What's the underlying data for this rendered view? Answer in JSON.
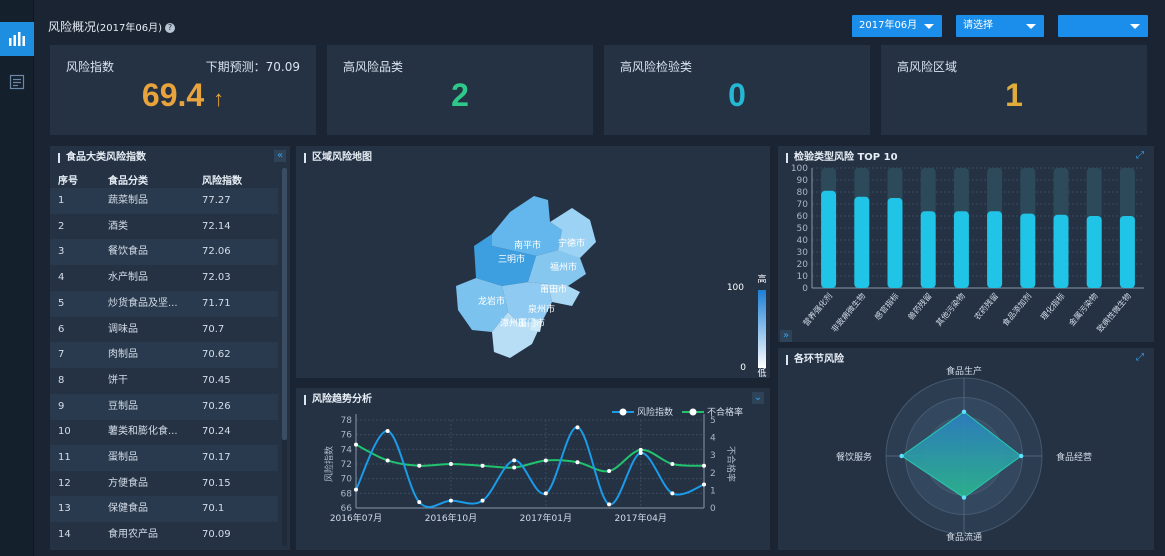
{
  "header": {
    "title": "风险概况",
    "period": "(2017年06月)",
    "help": "?",
    "month_select": "2017年06月",
    "category_select": "请选择",
    "region_select": ""
  },
  "kpis": [
    {
      "label": "风险指数",
      "value": "69.4",
      "trend": "↑",
      "forecast": "下期预测：70.09",
      "color": "#e8a33c"
    },
    {
      "label": "高风险品类",
      "value": "2",
      "color": "#2ec98a"
    },
    {
      "label": "高风险检验类",
      "value": "0",
      "color": "#25b7d3"
    },
    {
      "label": "高风险区域",
      "value": "1",
      "color": "#e0ad3a"
    }
  ],
  "food_table": {
    "title": "食品大类风险指数",
    "columns": [
      "序号",
      "食品分类",
      "风险指数"
    ],
    "rows": [
      [
        "1",
        "蔬菜制品",
        "77.27"
      ],
      [
        "2",
        "酒类",
        "72.14"
      ],
      [
        "3",
        "餐饮食品",
        "72.06"
      ],
      [
        "4",
        "水产制品",
        "72.03"
      ],
      [
        "5",
        "炒货食品及坚...",
        "71.71"
      ],
      [
        "6",
        "调味品",
        "70.7"
      ],
      [
        "7",
        "肉制品",
        "70.62"
      ],
      [
        "8",
        "饼干",
        "70.45"
      ],
      [
        "9",
        "豆制品",
        "70.26"
      ],
      [
        "10",
        "薯类和膨化食...",
        "70.24"
      ],
      [
        "11",
        "蛋制品",
        "70.17"
      ],
      [
        "12",
        "方便食品",
        "70.15"
      ],
      [
        "13",
        "保健食品",
        "70.1"
      ],
      [
        "14",
        "食用农产品",
        "70.09"
      ]
    ]
  },
  "map": {
    "title": "区域风险地图",
    "cities": [
      "南平市",
      "宁德市",
      "三明市",
      "福州市",
      "莆田市",
      "龙岩市",
      "泉州市",
      "漳州市",
      "厦门市"
    ],
    "legend_high": "高",
    "legend_low": "低",
    "legend_max": "100",
    "legend_min": "0"
  },
  "trend": {
    "title": "风险趋势分析",
    "legend": [
      "风险指数",
      "不合格率"
    ],
    "left_axis_label": "风险指数",
    "right_axis_label": "不合格率",
    "x_ticks": [
      "2016年07月",
      "2016年10月",
      "2017年01月",
      "2017年04月"
    ]
  },
  "inspection": {
    "title": "检验类型风险 TOP 10"
  },
  "radar": {
    "title": "各环节风险",
    "axes": [
      "食品生产",
      "食品经营",
      "食品流通",
      "餐饮服务"
    ]
  },
  "chart_data": [
    {
      "type": "line",
      "x": [
        "2016年07月",
        "2016年08月",
        "2016年09月",
        "2016年10月",
        "2016年11月",
        "2016年12月",
        "2017年01月",
        "2017年02月",
        "2017年03月",
        "2017年04月",
        "2017年05月",
        "2017年06月"
      ],
      "series": [
        {
          "name": "风险指数",
          "axis": "left",
          "values": [
            68.5,
            76.5,
            66.8,
            67,
            67,
            72.5,
            68,
            77,
            66.5,
            73.5,
            68,
            69.2
          ]
        },
        {
          "name": "不合格率",
          "axis": "right",
          "values": [
            3.6,
            2.7,
            2.4,
            2.5,
            2.4,
            2.3,
            2.7,
            2.6,
            2.1,
            3.3,
            2.5,
            2.4
          ]
        }
      ],
      "left_ylim": [
        66,
        78
      ],
      "left_ticks": [
        66,
        68,
        70,
        72,
        74,
        76,
        78
      ],
      "right_ylim": [
        0,
        5
      ],
      "right_ticks": [
        0,
        1,
        2,
        3,
        4,
        5
      ],
      "ylabel": "风险指数",
      "y2label": "不合格率",
      "grid": true
    },
    {
      "type": "bar",
      "categories": [
        "营养强化剂",
        "非致病微生物",
        "感官指标",
        "兽药残留",
        "其他污染物",
        "农药残留",
        "食品添加剂",
        "理化指标",
        "金属污染物",
        "致病性微生物"
      ],
      "values": [
        81,
        76,
        75,
        64,
        64,
        64,
        62,
        61,
        60,
        60
      ],
      "background": 100,
      "ylim": [
        0,
        100
      ],
      "yticks": [
        0,
        10,
        20,
        30,
        40,
        50,
        60,
        70,
        80,
        90,
        100
      ],
      "title": "检验类型风险 TOP 10"
    },
    {
      "type": "radar",
      "categories": [
        "食品生产",
        "食品经营",
        "食品流通",
        "餐饮服务"
      ],
      "values": [
        85,
        110,
        80,
        120
      ],
      "max": 150
    }
  ],
  "colors": {
    "accent": "#1a8eea",
    "panel": "#243244",
    "background": "#1a2433",
    "bar": "#1fc4e6",
    "bar_bg": "#2c4a5a",
    "risk_line": "#1b9be8",
    "rate_line": "#22c36f"
  }
}
